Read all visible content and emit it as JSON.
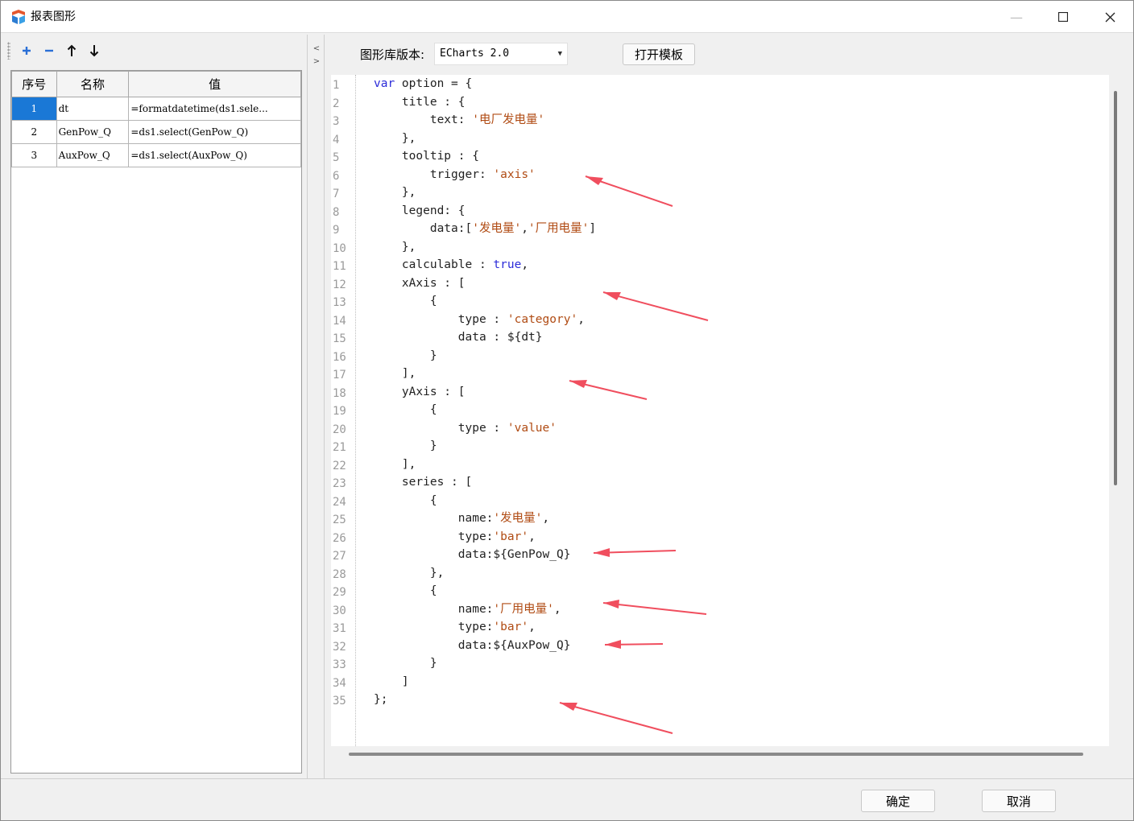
{
  "window": {
    "title": "报表图形",
    "minimize_icon": "minimize-icon",
    "maximize_icon": "maximize-icon",
    "close_icon": "close-icon"
  },
  "toolbar": {
    "add_icon": "plus-icon",
    "remove_icon": "minus-icon",
    "up_icon": "arrow-up-icon",
    "down_icon": "arrow-down-icon"
  },
  "params_table": {
    "headers": [
      "序号",
      "名称",
      "值"
    ],
    "rows": [
      {
        "index": "1",
        "name": "dt",
        "value": "=formatdatetime(ds1.sele...",
        "selected": true
      },
      {
        "index": "2",
        "name": "GenPow_Q",
        "value": "=ds1.select(GenPow_Q)",
        "selected": false
      },
      {
        "index": "3",
        "name": "AuxPow_Q",
        "value": "=ds1.select(AuxPow_Q)",
        "selected": false
      }
    ]
  },
  "splitter": {
    "collapse_left": "<",
    "expand_right": ">"
  },
  "chart_lib": {
    "label": "图形库版本:",
    "selected": "ECharts 2.0",
    "open_template_label": "打开模板"
  },
  "editor": {
    "lines": [
      [
        [
          "kw",
          "var"
        ],
        [
          "p",
          " option = {"
        ]
      ],
      [
        [
          "p",
          "    title : {"
        ]
      ],
      [
        [
          "p",
          "        text: "
        ],
        [
          "str",
          "'电厂发电量'"
        ]
      ],
      [
        [
          "p",
          "    },"
        ]
      ],
      [
        [
          "p",
          "    tooltip : {"
        ]
      ],
      [
        [
          "p",
          "        trigger: "
        ],
        [
          "str",
          "'axis'"
        ]
      ],
      [
        [
          "p",
          "    },"
        ]
      ],
      [
        [
          "p",
          "    legend: {"
        ]
      ],
      [
        [
          "p",
          "        data:["
        ],
        [
          "str",
          "'发电量'"
        ],
        [
          "p",
          ","
        ],
        [
          "str",
          "'厂用电量'"
        ],
        [
          "p",
          "]"
        ]
      ],
      [
        [
          "p",
          "    },"
        ]
      ],
      [
        [
          "p",
          "    calculable : "
        ],
        [
          "kw",
          "true"
        ],
        [
          "p",
          ","
        ]
      ],
      [
        [
          "p",
          "    xAxis : ["
        ]
      ],
      [
        [
          "p",
          "        {"
        ]
      ],
      [
        [
          "p",
          "            type : "
        ],
        [
          "str",
          "'category'"
        ],
        [
          "p",
          ","
        ]
      ],
      [
        [
          "p",
          "            data : ${dt}"
        ]
      ],
      [
        [
          "p",
          "        }"
        ]
      ],
      [
        [
          "p",
          "    ],"
        ]
      ],
      [
        [
          "p",
          "    yAxis : ["
        ]
      ],
      [
        [
          "p",
          "        {"
        ]
      ],
      [
        [
          "p",
          "            type : "
        ],
        [
          "str",
          "'value'"
        ]
      ],
      [
        [
          "p",
          "        }"
        ]
      ],
      [
        [
          "p",
          "    ],"
        ]
      ],
      [
        [
          "p",
          "    series : ["
        ]
      ],
      [
        [
          "p",
          "        {"
        ]
      ],
      [
        [
          "p",
          "            name:"
        ],
        [
          "str",
          "'发电量'"
        ],
        [
          "p",
          ","
        ]
      ],
      [
        [
          "p",
          "            type:"
        ],
        [
          "str",
          "'bar'"
        ],
        [
          "p",
          ","
        ]
      ],
      [
        [
          "p",
          "            data:${GenPow_Q}"
        ]
      ],
      [
        [
          "p",
          "        },"
        ]
      ],
      [
        [
          "p",
          "        {"
        ]
      ],
      [
        [
          "p",
          "            name:"
        ],
        [
          "str",
          "'厂用电量'"
        ],
        [
          "p",
          ","
        ]
      ],
      [
        [
          "p",
          "            type:"
        ],
        [
          "str",
          "'bar'"
        ],
        [
          "p",
          ","
        ]
      ],
      [
        [
          "p",
          "            data:${AuxPow_Q}"
        ]
      ],
      [
        [
          "p",
          "        }"
        ]
      ],
      [
        [
          "p",
          "    ]"
        ]
      ],
      [
        [
          "p",
          "};"
        ]
      ]
    ],
    "annotation_color": "#f04e5e"
  },
  "footer": {
    "ok_label": "确定",
    "cancel_label": "取消"
  },
  "colors": {
    "selection": "#1a78d6",
    "keyword": "#2b2bd8",
    "string": "#b04b13",
    "toolbar_blue": "#2a6fd6"
  }
}
